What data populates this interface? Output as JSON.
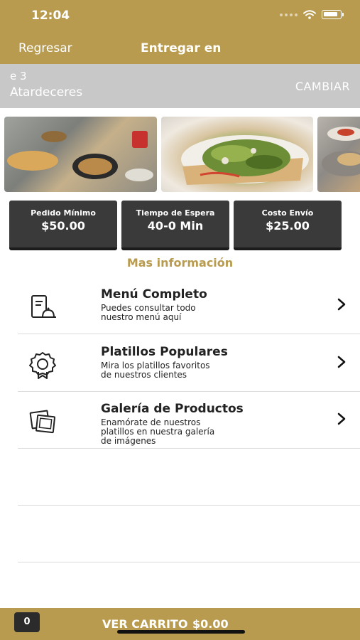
{
  "status": {
    "time": "12:04"
  },
  "nav": {
    "back_label": "Regresar",
    "title": "Entregar en"
  },
  "address": {
    "line1": "e 3",
    "line2": "Atardeceres",
    "change_label": "CAMBIAR"
  },
  "info_cards": [
    {
      "label": "Pedido Mínimo",
      "value": "$50.00"
    },
    {
      "label": "Tiempo de Espera",
      "value": "40-0 Min"
    },
    {
      "label": "Costo Envío",
      "value": "$25.00"
    }
  ],
  "more_info_label": "Mas información",
  "menu_rows": [
    {
      "icon": "menu-document-icon",
      "title": "Menú Completo",
      "desc_lines": [
        "Puedes consultar todo",
        "nuestro menú aquí"
      ]
    },
    {
      "icon": "award-ribbon-icon",
      "title": "Platillos Populares",
      "desc_lines": [
        "Mira los platillos favoritos",
        "de nuestros clientes"
      ]
    },
    {
      "icon": "photo-gallery-icon",
      "title": "Galería de Productos",
      "desc_lines": [
        "Enamórate de nuestros",
        "platillos en nuestra galería",
        "de imágenes"
      ]
    }
  ],
  "cart": {
    "count": "0",
    "label": "VER CARRITO",
    "total": "$0.00"
  },
  "colors": {
    "brand": "#b89b4f",
    "card": "#3a3a3a",
    "address_bg": "#c8c8c8"
  }
}
